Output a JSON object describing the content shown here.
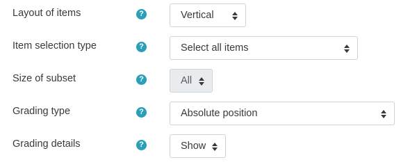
{
  "fields": [
    {
      "label": "Layout of items",
      "value": "Vertical",
      "help_icon": "question-circle-icon"
    },
    {
      "label": "Item selection type",
      "value": "Select all items",
      "help_icon": "question-circle-icon"
    },
    {
      "label": "Size of subset",
      "value": "All",
      "disabled": true,
      "help_icon": "question-circle-icon"
    },
    {
      "label": "Grading type",
      "value": "Absolute position",
      "help_icon": "question-circle-icon"
    },
    {
      "label": "Grading details",
      "value": "Show",
      "help_icon": "question-circle-icon"
    }
  ],
  "help_glyph": "?",
  "colors": {
    "help_icon": "#2a9fb8",
    "text": "#373a3c",
    "select_border": "#ced4da",
    "disabled_bg": "#e9ecef"
  }
}
